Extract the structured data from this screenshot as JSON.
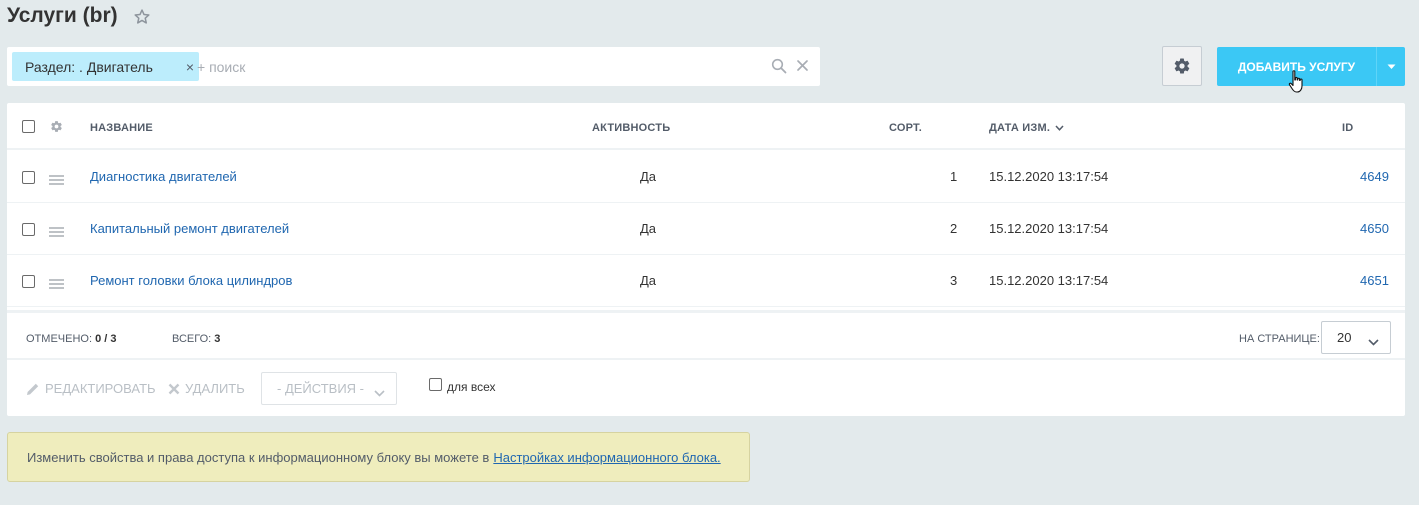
{
  "page": {
    "title": "Услуги (br)"
  },
  "filter": {
    "chip_label": "Раздел: . Двигатель",
    "chip_close": "×",
    "placeholder": "+ поиск"
  },
  "toolbar": {
    "add_label": "ДОБАВИТЬ УСЛУГУ"
  },
  "grid": {
    "columns": {
      "name": "НАЗВАНИЕ",
      "active": "АКТИВНОСТЬ",
      "sort": "СОРТ.",
      "date": "ДАТА ИЗМ.",
      "id": "ID"
    },
    "rows": [
      {
        "name": "Диагностика двигателей",
        "active": "Да",
        "sort": "1",
        "date": "15.12.2020 13:17:54",
        "id": "4649"
      },
      {
        "name": "Капитальный ремонт двигателей",
        "active": "Да",
        "sort": "2",
        "date": "15.12.2020 13:17:54",
        "id": "4650"
      },
      {
        "name": "Ремонт головки блока цилиндров",
        "active": "Да",
        "sort": "3",
        "date": "15.12.2020 13:17:54",
        "id": "4651"
      }
    ],
    "footer": {
      "selected_label": "ОТМЕЧЕНО:",
      "selected_value": "0 / 3",
      "total_label": "ВСЕГО:",
      "total_value": "3",
      "per_page_label": "НА СТРАНИЦЕ:",
      "per_page_value": "20"
    },
    "actions": {
      "edit": "РЕДАКТИРОВАТЬ",
      "delete": "УДАЛИТЬ",
      "actions_select": "- ДЕЙСТВИЯ -",
      "for_all": "для всех"
    }
  },
  "notice": {
    "text": "Изменить свойства и права доступа к информационному блоку вы можете в",
    "link": "Настройках информационного блока."
  },
  "colors": {
    "background": "#e3eaec",
    "accent": "#3bc8f5",
    "chip": "#bcedfc",
    "link": "#2067b0",
    "notice": "#efedbd"
  },
  "icons": [
    "star-icon",
    "search-icon",
    "close-icon",
    "gear-icon",
    "chevron-down-icon",
    "hand-cursor-icon",
    "drag-handle-icon",
    "pencil-icon",
    "cross-icon"
  ]
}
